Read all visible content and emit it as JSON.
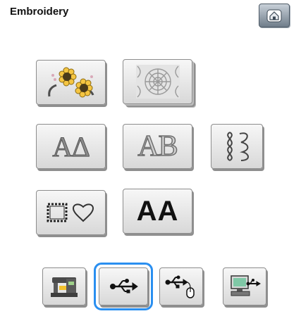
{
  "header": {
    "title": "Embroidery",
    "home_icon": "home-icon"
  },
  "categories": {
    "patterns": [
      {
        "name": "floral-pattern-icon"
      },
      {
        "name": "decorative-pattern-icon"
      }
    ],
    "fonts": [
      {
        "name": "alphabet-font-icon",
        "glyphs": "AΔ"
      },
      {
        "name": "embroidery-font-icon",
        "glyphs": "AB"
      },
      {
        "name": "monogram-font-icon"
      }
    ],
    "frames": [
      {
        "name": "frame-pattern-icon"
      },
      {
        "name": "character-font-icon",
        "glyphs": "AA"
      }
    ]
  },
  "sources": [
    {
      "name": "machine-memory-icon",
      "selected": false
    },
    {
      "name": "usb-icon",
      "selected": true
    },
    {
      "name": "usb-mouse-icon",
      "selected": false
    },
    {
      "name": "computer-usb-icon",
      "selected": false
    }
  ],
  "colors": {
    "selection": "#2a8ff0",
    "home_button": "#6f7d8a"
  }
}
